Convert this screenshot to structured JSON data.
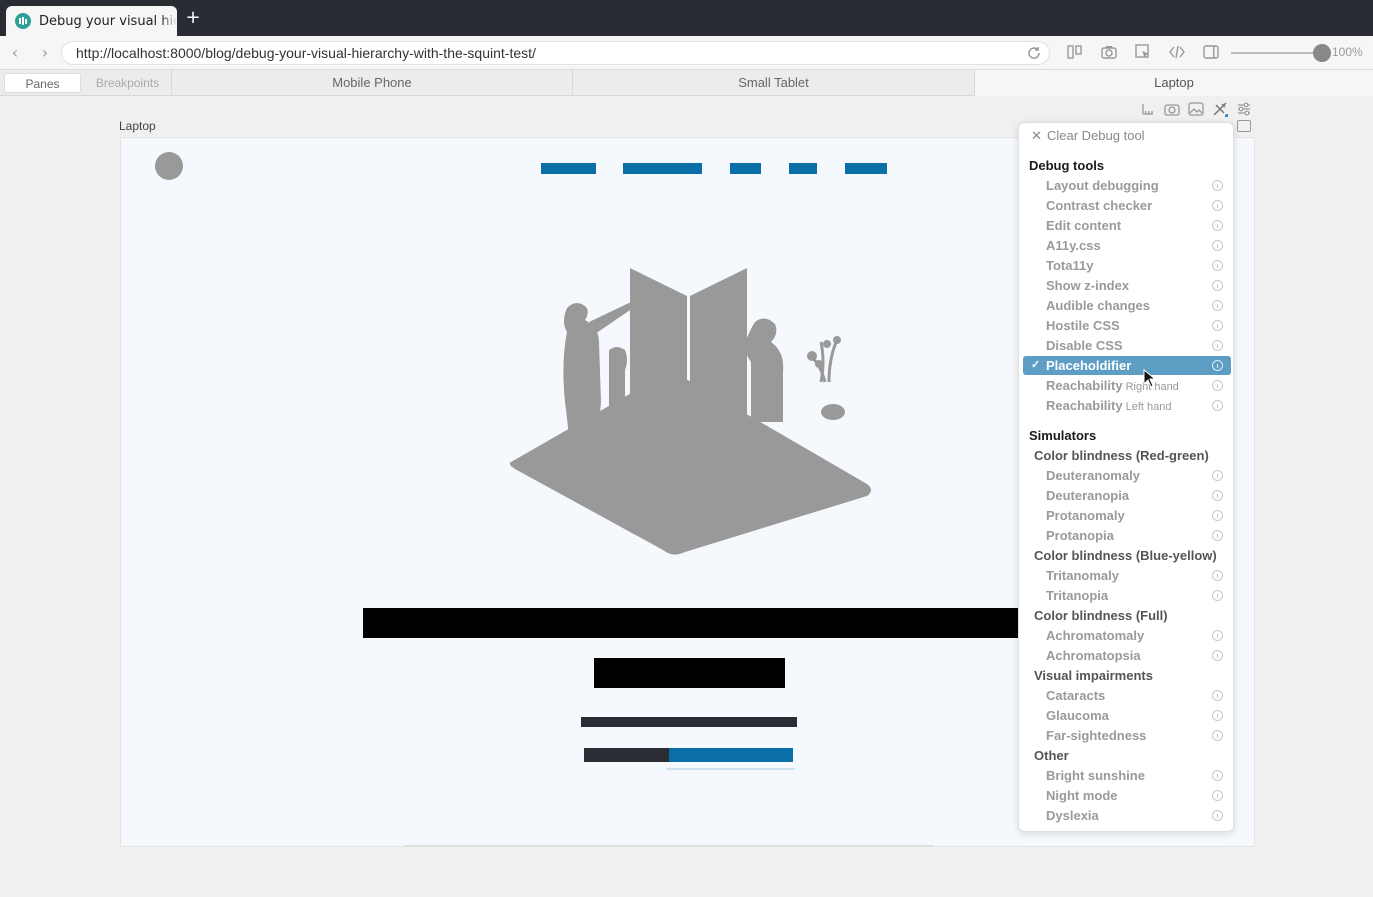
{
  "browser": {
    "tab_title": "Debug your visual hie",
    "new_tab_label": "+",
    "url": "http://localhost:8000/blog/debug-your-visual-hierarchy-with-the-squint-test/",
    "zoom": "100%",
    "zoom_level": 1.0
  },
  "pane_bar": {
    "segments": [
      "Panes",
      "Breakpoints"
    ],
    "active_segment": "Panes",
    "devices": [
      "Mobile Phone",
      "Small Tablet",
      "Laptop"
    ],
    "active_device": "Laptop"
  },
  "pane": {
    "label": "Laptop"
  },
  "debug_menu": {
    "clear_label": "Clear Debug tool",
    "debug_tools_title": "Debug tools",
    "debug_tools": [
      {
        "label": "Layout debugging"
      },
      {
        "label": "Contrast checker"
      },
      {
        "label": "Edit content"
      },
      {
        "label": "A11y.css"
      },
      {
        "label": "Tota11y"
      },
      {
        "label": "Show z-index"
      },
      {
        "label": "Audible changes"
      },
      {
        "label": "Hostile CSS"
      },
      {
        "label": "Disable CSS"
      },
      {
        "label": "Placeholdifier",
        "selected": true
      },
      {
        "label": "Reachability",
        "sub": "Right hand"
      },
      {
        "label": "Reachability",
        "sub": "Left hand"
      }
    ],
    "simulators_title": "Simulators",
    "simulator_groups": [
      {
        "title": "Color blindness (Red-green)",
        "items": [
          "Deuteranomaly",
          "Deuteranopia",
          "Protanomaly",
          "Protanopia"
        ]
      },
      {
        "title": "Color blindness (Blue-yellow)",
        "items": [
          "Tritanomaly",
          "Tritanopia"
        ]
      },
      {
        "title": "Color blindness (Full)",
        "items": [
          "Achromatomaly",
          "Achromatopsia"
        ]
      },
      {
        "title": "Visual impairments",
        "items": [
          "Cataracts",
          "Glaucoma",
          "Far-sightedness"
        ]
      },
      {
        "title": "Other",
        "items": [
          "Bright sunshine",
          "Night mode",
          "Dyslexia"
        ]
      }
    ]
  },
  "colors": {
    "accent": "#0a6fa6",
    "selected_item": "#5f9ec4",
    "placeholder_gray": "#999999",
    "chrome_dark": "#2a2c33"
  }
}
